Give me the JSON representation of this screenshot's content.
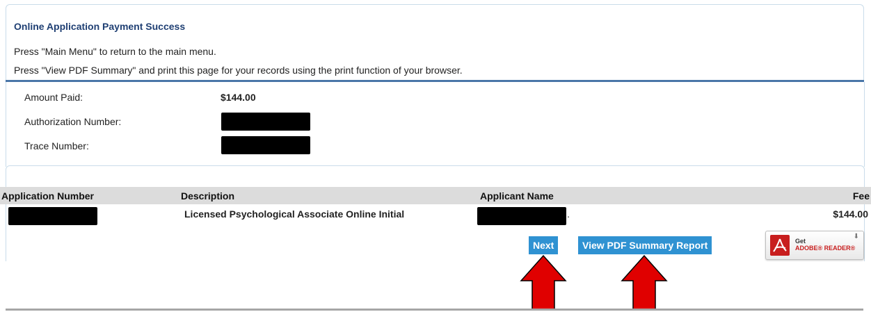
{
  "panel": {
    "title": "Online Application Payment Success",
    "line1": "Press \"Main Menu\" to return to the main menu.",
    "line2": "Press \"View PDF Summary\" and print this page for your records using the print function of your browser."
  },
  "details": {
    "amount_paid_label": "Amount Paid:",
    "amount_paid_value": "$144.00",
    "authorization_label": "Authorization Number:",
    "trace_label": "Trace Number:"
  },
  "table": {
    "headers": [
      "Application Number",
      "Description",
      "Applicant Name",
      "Fee"
    ],
    "row": {
      "description": "Licensed Psychological Associate Online Initial",
      "applicant_suffix": ".",
      "fee": "$144.00"
    }
  },
  "buttons": {
    "next": "Next",
    "view_pdf": "View PDF Summary Report"
  },
  "adobe_badge": {
    "get": "Get",
    "name": "ADOBE® READER®",
    "download_icon": "download-arrow-icon"
  },
  "colors": {
    "title": "#1f3f73",
    "button": "#2f92d2",
    "rule": "#4a76a8",
    "table_header": "#dcdcdc",
    "arrow": "#e00000"
  },
  "icons": {
    "adobe": "adobe-reader-icon",
    "annotation": "red-up-arrow-icon"
  }
}
